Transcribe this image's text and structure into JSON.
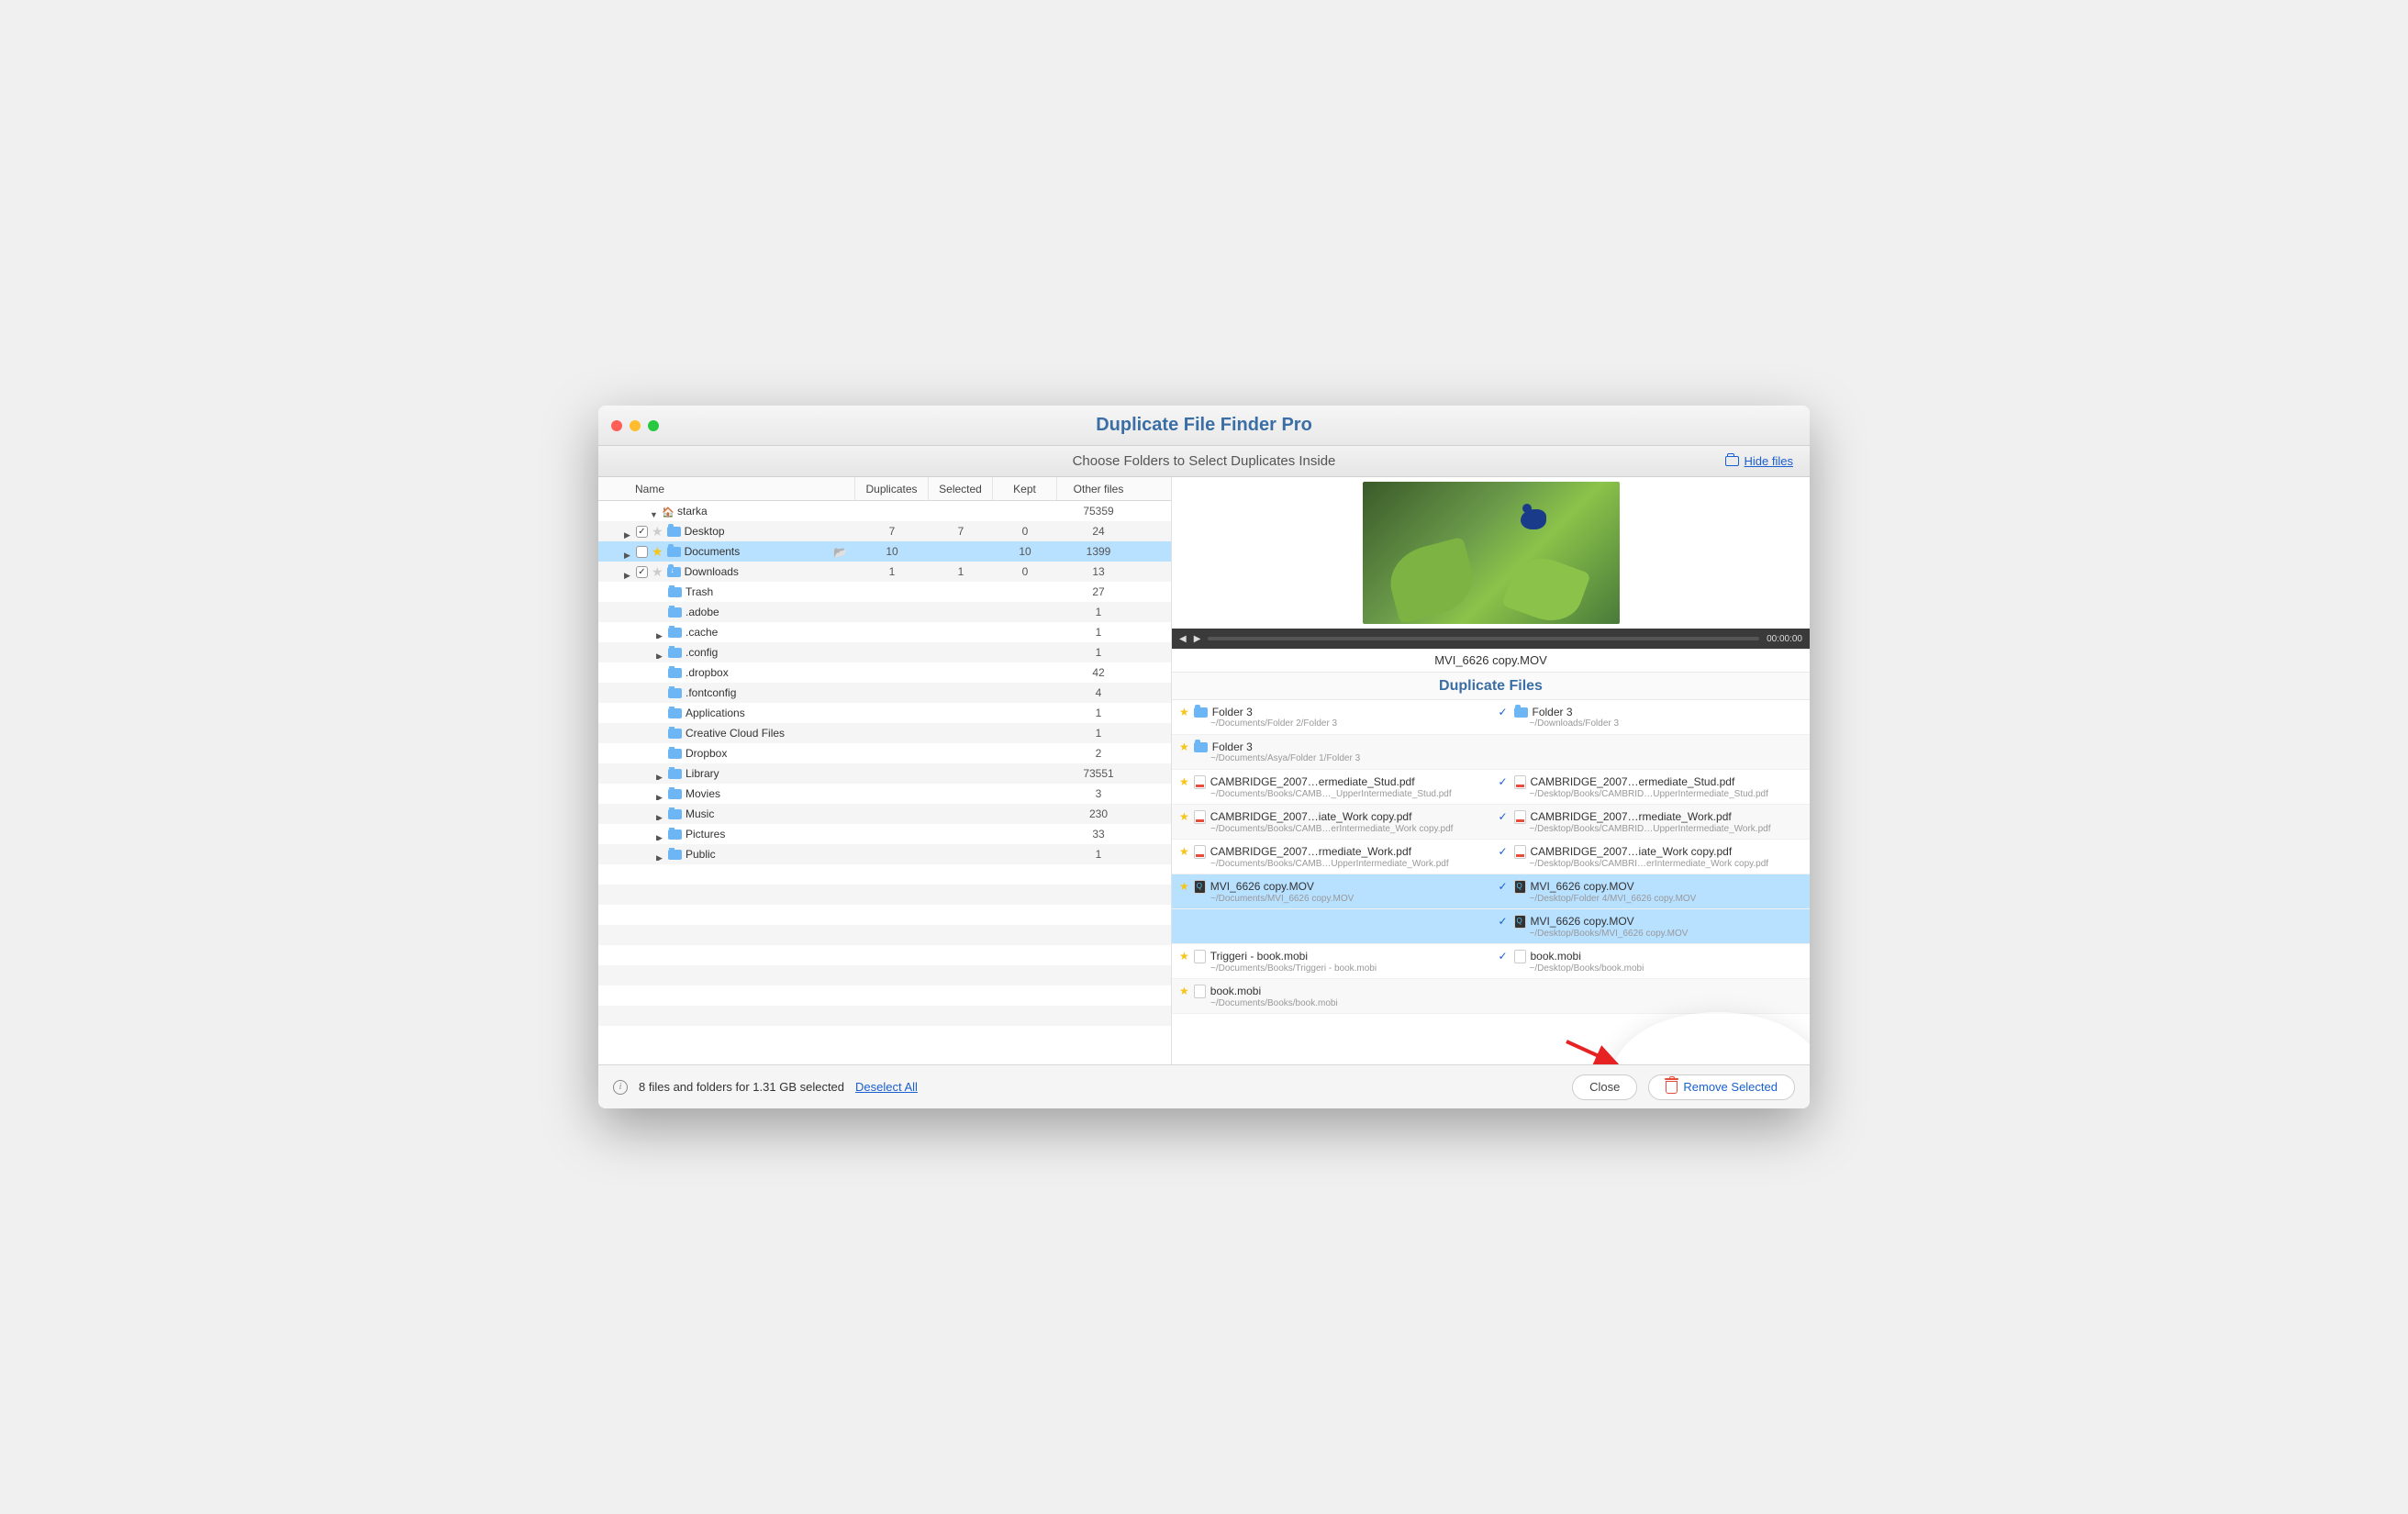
{
  "title": "Duplicate File Finder Pro",
  "subtitle": "Choose Folders to Select Duplicates Inside",
  "hideFiles": "Hide files",
  "columns": {
    "name": "Name",
    "dup": "Duplicates",
    "sel": "Selected",
    "kept": "Kept",
    "oth": "Other files"
  },
  "tree": [
    {
      "type": "root",
      "name": "starka",
      "oth": "75359",
      "indent": 0,
      "expanded": true,
      "home": true
    },
    {
      "type": "folder",
      "name": "Desktop",
      "dup": "7",
      "sel": "7",
      "kept": "0",
      "oth": "24",
      "indent": 1,
      "tri": "r",
      "cb": true,
      "cbOn": true,
      "star": true,
      "starOn": false
    },
    {
      "type": "folder",
      "name": "Documents",
      "dup": "10",
      "sel": "",
      "kept": "10",
      "oth": "1399",
      "indent": 1,
      "tri": "r",
      "cb": true,
      "cbOn": false,
      "star": true,
      "starOn": true,
      "selected": true,
      "open": true
    },
    {
      "type": "folder",
      "name": "Downloads",
      "dup": "1",
      "sel": "1",
      "kept": "0",
      "oth": "13",
      "indent": 1,
      "tri": "r",
      "cb": true,
      "cbOn": true,
      "star": true,
      "starOn": false,
      "dl": true
    },
    {
      "type": "folder",
      "name": "Trash",
      "oth": "27",
      "indent": 1
    },
    {
      "type": "folder",
      "name": ".adobe",
      "oth": "1",
      "indent": 1
    },
    {
      "type": "folder",
      "name": ".cache",
      "oth": "1",
      "indent": 1,
      "tri": "r"
    },
    {
      "type": "folder",
      "name": ".config",
      "oth": "1",
      "indent": 1,
      "tri": "r"
    },
    {
      "type": "folder",
      "name": ".dropbox",
      "oth": "42",
      "indent": 1
    },
    {
      "type": "folder",
      "name": ".fontconfig",
      "oth": "4",
      "indent": 1
    },
    {
      "type": "folder",
      "name": "Applications",
      "oth": "1",
      "indent": 1
    },
    {
      "type": "folder",
      "name": "Creative Cloud Files",
      "oth": "1",
      "indent": 1
    },
    {
      "type": "folder",
      "name": "Dropbox",
      "oth": "2",
      "indent": 1
    },
    {
      "type": "folder",
      "name": "Library",
      "oth": "73551",
      "indent": 1,
      "tri": "r"
    },
    {
      "type": "folder",
      "name": "Movies",
      "oth": "3",
      "indent": 1,
      "tri": "r"
    },
    {
      "type": "folder",
      "name": "Music",
      "oth": "230",
      "indent": 1,
      "tri": "r"
    },
    {
      "type": "folder",
      "name": "Pictures",
      "oth": "33",
      "indent": 1,
      "tri": "r"
    },
    {
      "type": "folder",
      "name": "Public",
      "oth": "1",
      "indent": 1,
      "tri": "r"
    }
  ],
  "player": {
    "time": "00:00:00"
  },
  "previewName": "MVI_6626 copy.MOV",
  "dupHeader": "Duplicate Files",
  "dupRows": [
    {
      "l": {
        "star": true,
        "fld": true,
        "name": "Folder 3",
        "path": "~/Documents/Folder 2/Folder 3"
      },
      "r": {
        "chk": true,
        "fld": true,
        "name": "Folder 3",
        "path": "~/Downloads/Folder 3"
      }
    },
    {
      "l": {
        "star": true,
        "fld": true,
        "name": "Folder 3",
        "path": "~/Documents/Asya/Folder 1/Folder 3"
      },
      "r": null,
      "alt": true
    },
    {
      "l": {
        "star": true,
        "ic": "pdf",
        "name": "CAMBRIDGE_2007…ermediate_Stud.pdf",
        "path": "~/Documents/Books/CAMB…_UpperIntermediate_Stud.pdf"
      },
      "r": {
        "chk": true,
        "ic": "pdf",
        "name": "CAMBRIDGE_2007…ermediate_Stud.pdf",
        "path": "~/Desktop/Books/CAMBRID…UpperIntermediate_Stud.pdf"
      }
    },
    {
      "l": {
        "star": true,
        "ic": "pdf",
        "name": "CAMBRIDGE_2007…iate_Work copy.pdf",
        "path": "~/Documents/Books/CAMB…erIntermediate_Work copy.pdf"
      },
      "r": {
        "chk": true,
        "ic": "pdf",
        "name": "CAMBRIDGE_2007…rmediate_Work.pdf",
        "path": "~/Desktop/Books/CAMBRID…UpperIntermediate_Work.pdf"
      },
      "alt": true
    },
    {
      "l": {
        "star": true,
        "ic": "pdf",
        "name": "CAMBRIDGE_2007…rmediate_Work.pdf",
        "path": "~/Documents/Books/CAMB…UpperIntermediate_Work.pdf"
      },
      "r": {
        "chk": true,
        "ic": "pdf",
        "name": "CAMBRIDGE_2007…iate_Work copy.pdf",
        "path": "~/Desktop/Books/CAMBRI…erIntermediate_Work copy.pdf"
      }
    },
    {
      "l": {
        "star": true,
        "ic": "mov",
        "name": "MVI_6626 copy.MOV",
        "path": "~/Documents/MVI_6626 copy.MOV"
      },
      "r": {
        "chk": true,
        "ic": "mov",
        "name": "MVI_6626 copy.MOV",
        "path": "~/Desktop/Folder 4/MVI_6626 copy.MOV"
      },
      "sel": true
    },
    {
      "l": null,
      "r": {
        "chk": true,
        "ic": "mov",
        "name": "MVI_6626 copy.MOV",
        "path": "~/Desktop/Books/MVI_6626 copy.MOV"
      },
      "sel": true
    },
    {
      "l": {
        "star": true,
        "ic": "file",
        "name": "Triggeri - book.mobi",
        "path": "~/Documents/Books/Triggeri - book.mobi"
      },
      "r": {
        "chk": true,
        "ic": "file",
        "name": "book.mobi",
        "path": "~/Desktop/Books/book.mobi"
      }
    },
    {
      "l": {
        "star": true,
        "ic": "file",
        "name": "book.mobi",
        "path": "~/Documents/Books/book.mobi"
      },
      "r": null,
      "alt": true
    }
  ],
  "footer": {
    "status": "8 files and folders for 1.31 GB selected",
    "deselect": "Deselect All",
    "close": "Close",
    "remove": "Remove Selected"
  }
}
